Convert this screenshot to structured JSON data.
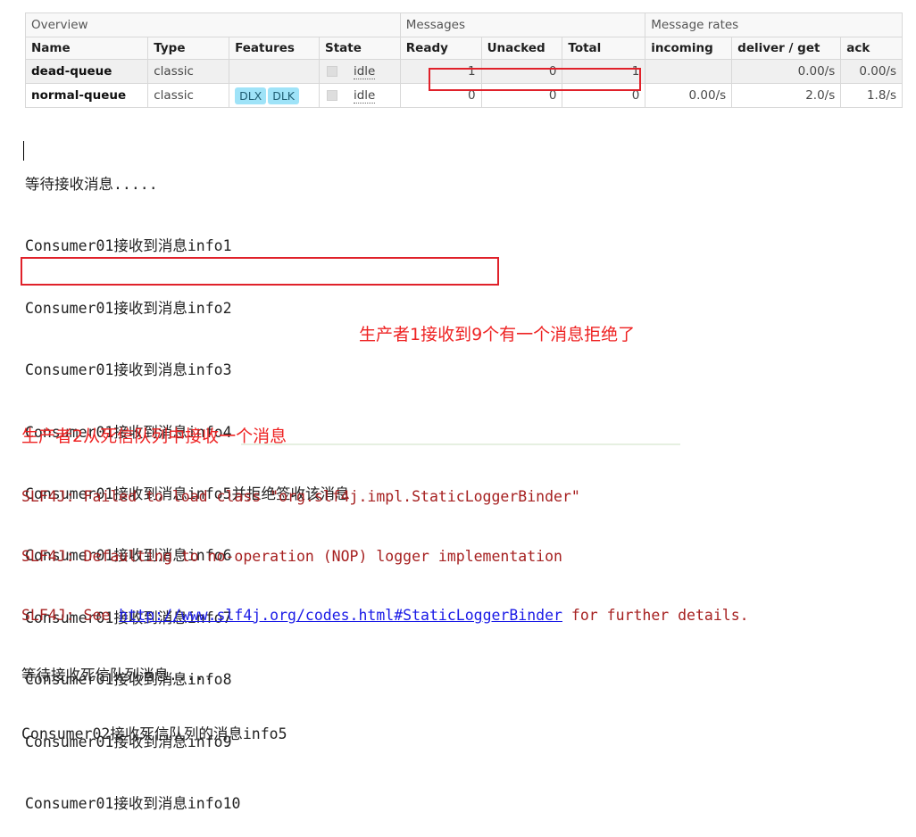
{
  "queues_table": {
    "group_headers": {
      "overview": "Overview",
      "messages": "Messages",
      "message_rates": "Message rates"
    },
    "columns": [
      "Name",
      "Type",
      "Features",
      "State",
      "Ready",
      "Unacked",
      "Total",
      "incoming",
      "deliver / get",
      "ack"
    ],
    "rows": [
      {
        "name": "dead-queue",
        "type": "classic",
        "features": [],
        "state": "idle",
        "ready": "1",
        "unacked": "0",
        "total": "1",
        "incoming": "",
        "deliver_get": "0.00/s",
        "ack": "0.00/s"
      },
      {
        "name": "normal-queue",
        "type": "classic",
        "features": [
          "DLX",
          "DLK"
        ],
        "state": "idle",
        "ready": "0",
        "unacked": "0",
        "total": "0",
        "incoming": "0.00/s",
        "deliver_get": "2.0/s",
        "ack": "1.8/s"
      }
    ]
  },
  "console1": {
    "lines": [
      "等待接收消息.....",
      "Consumer01接收到消息info1",
      "Consumer01接收到消息info2",
      "Consumer01接收到消息info3",
      "Consumer01接收到消息info4",
      "Consumer01接收到消息info5并拒绝签收该消息",
      "Consumer01接收到消息info6",
      "Consumer01接收到消息info7",
      "Consumer01接收到消息info8",
      "Consumer01接收到消息info9",
      "Consumer01接收到消息info10"
    ]
  },
  "annotations": {
    "note1": "生产者1接收到9个有一个消息拒绝了",
    "note2": "生产者2从死信队列中接收一个消息"
  },
  "console2": {
    "err1": "SLF4J: Failed to load class \"org.slf4j.impl.StaticLoggerBinder\"",
    "err2": "SLF4J: Defaulting to no-operation (NOP) logger implementation",
    "err3_prefix": "SLF4J: See ",
    "err3_link": "http://www.slf4j.org/codes.html#StaticLoggerBinder",
    "err3_suffix": " for further details.",
    "line4": "等待接收死信队列消息.....",
    "line5": "Consumer02接收死信队列的消息info5"
  },
  "colors": {
    "highlight_box": "#e0212a",
    "annotation": "#ee2222",
    "error_text": "#a62020",
    "link": "#1a1ae6",
    "feature_tag": "#9fe3f8"
  }
}
